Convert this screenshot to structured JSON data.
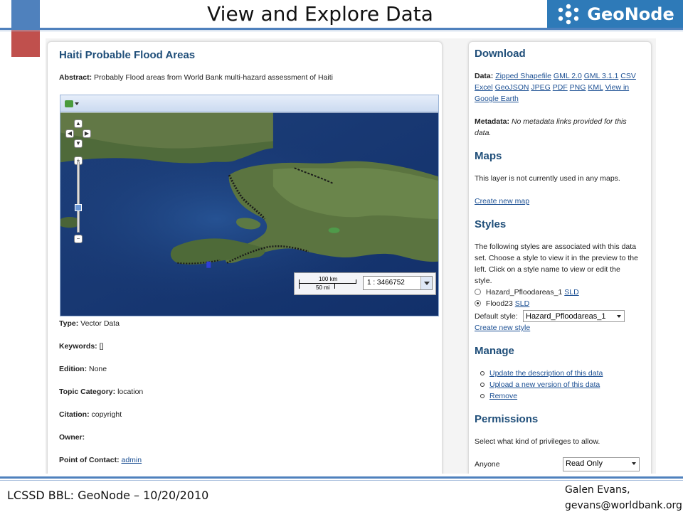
{
  "slide": {
    "title": "View and Explore Data",
    "logo_text": "GeoNode",
    "footer_left": "LCSSD BBL: GeoNode – 10/20/2010",
    "footer_right_line1": "Galen Evans,",
    "footer_right_line2": "gevans@worldbank.org"
  },
  "layer": {
    "title": "Haiti Probable Flood Areas",
    "abstract_label": "Abstract:",
    "abstract_text": "Probably Flood areas from World Bank multi-hazard assessment of Haiti",
    "map": {
      "scale_km": "100 km",
      "scale_mi": "50 mi",
      "scale_value": "1 : 3466752"
    },
    "meta": [
      {
        "label": "Type:",
        "value": "Vector Data"
      },
      {
        "label": "Keywords:",
        "value": "[]"
      },
      {
        "label": "Edition:",
        "value": "None"
      },
      {
        "label": "Topic Category:",
        "value": "location"
      },
      {
        "label": "Citation:",
        "value": "copyright"
      },
      {
        "label": "Owner:",
        "value": ""
      },
      {
        "label": "Point of Contact:",
        "value": "admin"
      }
    ]
  },
  "download": {
    "heading": "Download",
    "data_label": "Data:",
    "links": [
      "Zipped Shapefile",
      "GML 2.0",
      "GML 3.1.1",
      "CSV",
      "Excel",
      "GeoJSON",
      "JPEG",
      "PDF",
      "PNG",
      "KML",
      "View in Google Earth"
    ],
    "metadata_label": "Metadata:",
    "metadata_text": "No metadata links provided for this data."
  },
  "maps": {
    "heading": "Maps",
    "text": "This layer is not currently used in any maps.",
    "create_link": "Create new map"
  },
  "styles": {
    "heading": "Styles",
    "text": "The following styles are associated with this data set. Choose a style to view it in the preview to the left. Click on a style name to view or edit the style.",
    "items": [
      {
        "name": "Hazard_Pfloodareas_1",
        "link": "SLD",
        "selected": false
      },
      {
        "name": "Flood23",
        "link": "SLD",
        "selected": true
      }
    ],
    "default_label": "Default style:",
    "default_value": "Hazard_Pfloodareas_1",
    "create_link": "Create new style"
  },
  "manage": {
    "heading": "Manage",
    "links": [
      "Update the description of this data",
      "Upload a new version of this data",
      "Remove"
    ]
  },
  "permissions": {
    "heading": "Permissions",
    "text": "Select what kind of privileges to allow.",
    "anyone_label": "Anyone",
    "anyone_value": "Read Only"
  }
}
